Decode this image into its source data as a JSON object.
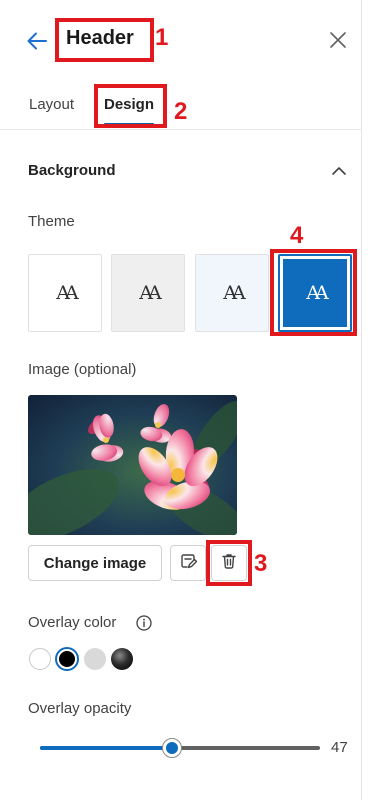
{
  "header": {
    "title": "Header"
  },
  "tabs": [
    {
      "label": "Layout"
    },
    {
      "label": "Design"
    }
  ],
  "section": {
    "title": "Background"
  },
  "theme": {
    "label": "Theme",
    "glyph": "AA",
    "selected_index": 3
  },
  "image": {
    "label": "Image (optional)",
    "change_label": "Change image"
  },
  "overlay": {
    "label": "Overlay color",
    "swatches": [
      "#ffffff",
      "#000000",
      "#d9d9d9",
      "#2d2d2d"
    ],
    "selected_index": 1
  },
  "opacity": {
    "label": "Overlay opacity",
    "value": "47",
    "fraction": 0.47
  },
  "annotations": [
    "1",
    "2",
    "3",
    "4"
  ],
  "colors": {
    "accent": "#0f6cbd",
    "annotation": "#e0191f"
  }
}
